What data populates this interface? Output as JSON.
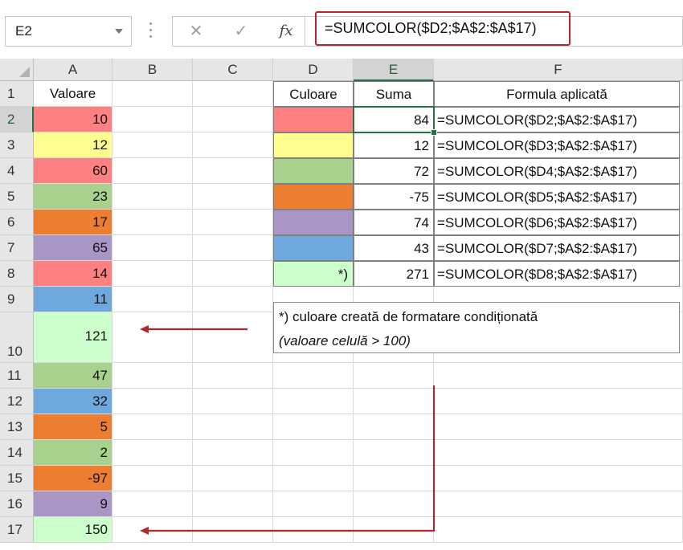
{
  "namebox": {
    "value": "E2"
  },
  "formula_bar": {
    "cancel_icon": "✕",
    "enter_icon": "✓",
    "fx_label": "fx",
    "formula": "=SUMCOLOR($D2;$A$2:$A$17)"
  },
  "columns": [
    "A",
    "B",
    "C",
    "D",
    "E",
    "F"
  ],
  "rows": [
    "1",
    "2",
    "3",
    "4",
    "5",
    "6",
    "7",
    "8",
    "9",
    "10",
    "11",
    "12",
    "13",
    "14",
    "15",
    "16",
    "17"
  ],
  "headers": {
    "A": "Valoare",
    "D": "Culoare",
    "E": "Suma",
    "F": "Formula aplicată"
  },
  "colors": {
    "red": "#ff8080",
    "yellow": "#ffff8f",
    "green": "#a9d18e",
    "orange": "#ed7d31",
    "purple": "#a995c6",
    "blue": "#6fa8dc",
    "lightgreen": "#ccffcc",
    "accent": "#217346",
    "highlight": "#b0272c"
  },
  "values_a": [
    {
      "value": "10",
      "color": "red"
    },
    {
      "value": "12",
      "color": "yellow"
    },
    {
      "value": "60",
      "color": "red"
    },
    {
      "value": "23",
      "color": "green"
    },
    {
      "value": "17",
      "color": "orange"
    },
    {
      "value": "65",
      "color": "purple"
    },
    {
      "value": "14",
      "color": "red"
    },
    {
      "value": "11",
      "color": "blue"
    },
    {
      "value": "121",
      "color": "lightgreen"
    },
    {
      "value": "47",
      "color": "green"
    },
    {
      "value": "32",
      "color": "blue"
    },
    {
      "value": "5",
      "color": "orange"
    },
    {
      "value": "2",
      "color": "green"
    },
    {
      "value": "-97",
      "color": "orange"
    },
    {
      "value": "9",
      "color": "purple"
    },
    {
      "value": "150",
      "color": "lightgreen"
    }
  ],
  "summary": [
    {
      "color": "red",
      "label": "",
      "sum": "84",
      "formula": "=SUMCOLOR($D2;$A$2:$A$17)"
    },
    {
      "color": "yellow",
      "label": "",
      "sum": "12",
      "formula": "=SUMCOLOR($D3;$A$2:$A$17)"
    },
    {
      "color": "green",
      "label": "",
      "sum": "72",
      "formula": "=SUMCOLOR($D4;$A$2:$A$17)"
    },
    {
      "color": "orange",
      "label": "",
      "sum": "-75",
      "formula": "=SUMCOLOR($D5;$A$2:$A$17)"
    },
    {
      "color": "purple",
      "label": "",
      "sum": "74",
      "formula": "=SUMCOLOR($D6;$A$2:$A$17)"
    },
    {
      "color": "blue",
      "label": "",
      "sum": "43",
      "formula": "=SUMCOLOR($D7;$A$2:$A$17)"
    },
    {
      "color": "lightgreen",
      "label": "*)",
      "sum": "271",
      "formula": "=SUMCOLOR($D8;$A$2:$A$17)"
    }
  ],
  "note": {
    "line1": "*) culoare creată de formatare condiționată",
    "line2": "(valoare celulă > 100)"
  }
}
